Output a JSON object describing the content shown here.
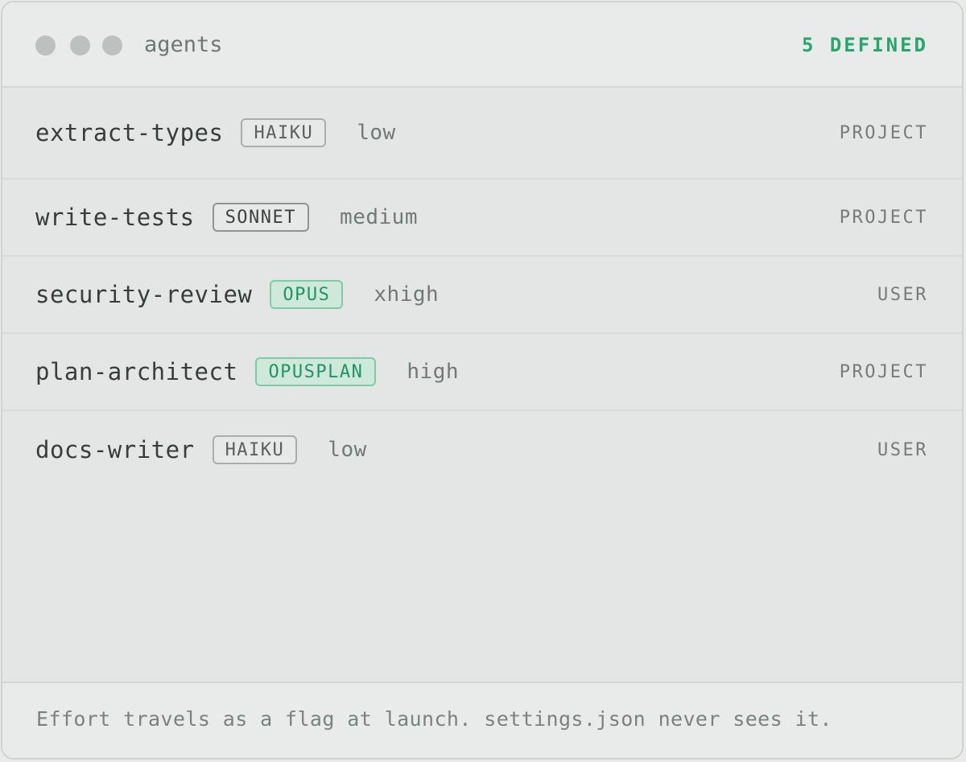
{
  "window": {
    "title": "agents",
    "count_label": "5 DEFINED"
  },
  "agents": [
    {
      "name": "extract-types",
      "model": "HAIKU",
      "effort": "low",
      "scope": "PROJECT"
    },
    {
      "name": "write-tests",
      "model": "SONNET",
      "effort": "medium",
      "scope": "PROJECT"
    },
    {
      "name": "security-review",
      "model": "OPUS",
      "effort": "xhigh",
      "scope": "USER"
    },
    {
      "name": "plan-architect",
      "model": "OPUSPLAN",
      "effort": "high",
      "scope": "PROJECT"
    },
    {
      "name": "docs-writer",
      "model": "HAIKU",
      "effort": "low",
      "scope": "USER"
    }
  ],
  "footer": {
    "note": "Effort travels as a flag at launch. settings.json never sees it."
  },
  "colors": {
    "accent": "#27a56d",
    "background": "#e3e6e4",
    "badge_green_bg": "#cfe8dc"
  }
}
